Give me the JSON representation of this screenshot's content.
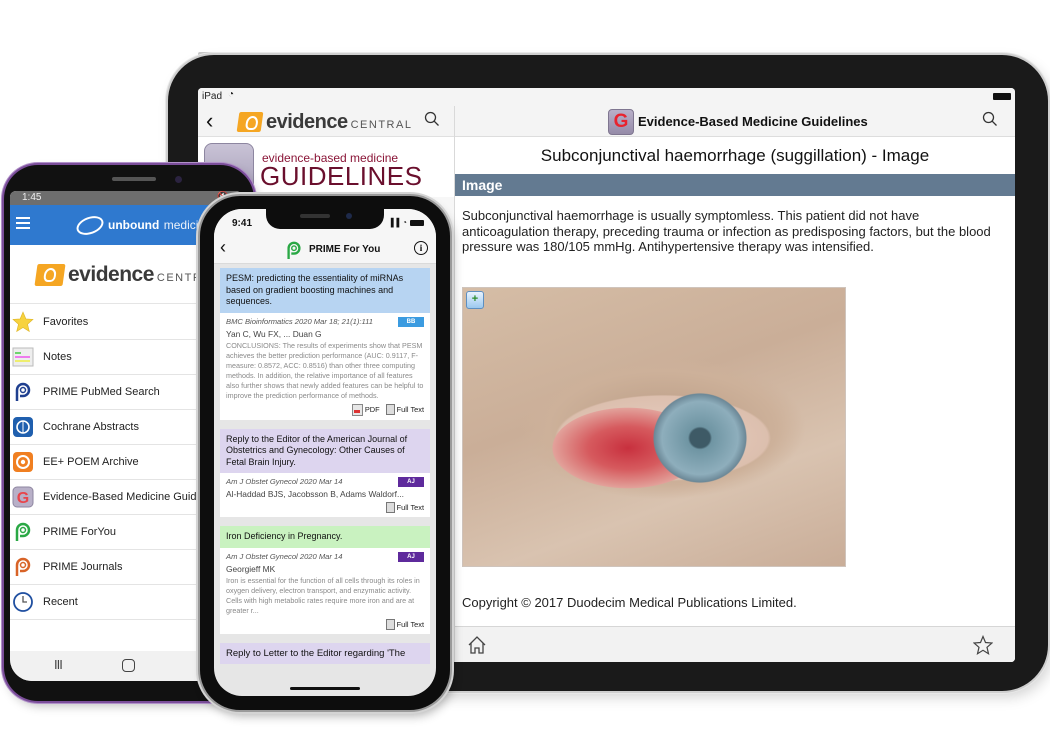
{
  "ipad": {
    "status": {
      "carrier": "iPad"
    },
    "left_pane": {
      "brand": {
        "word": "evidence",
        "suffix": "CENTRAL"
      },
      "banner": {
        "subtitle": "evidence-based medicine",
        "title": "GUIDELINES"
      }
    },
    "right_pane": {
      "app_icon_letter": "G",
      "nav_title": "Evidence-Based Medicine Guidelines",
      "doc_title": "Subconjunctival haemorrhage (suggillation) - Image",
      "section_header": "Image",
      "body": "Subconjunctival haemorrhage is usually symptomless. This patient did not have anticoagulation therapy, preceding trauma or infection as predisposing factors, but the blood pressure was 180/105 mmHg. Antihypertensive therapy was intensified.",
      "image_alt": "Photo of an eye with subconjunctival haemorrhage",
      "copyright": "Copyright © 2017 Duodecim Medical Publications Limited."
    },
    "colors": {
      "section_bar": "#637a91"
    }
  },
  "android": {
    "status": {
      "time": "1:45"
    },
    "header": {
      "brand_bold": "unbound",
      "brand_light": "medicine"
    },
    "logo": {
      "word": "evidence",
      "suffix": "CENTRAL"
    },
    "menu": [
      {
        "label": "Favorites",
        "icon": "star-icon"
      },
      {
        "label": "Notes",
        "icon": "notes-icon"
      },
      {
        "label": "PRIME PubMed Search",
        "icon": "prime-pubmed-icon"
      },
      {
        "label": "Cochrane Abstracts",
        "icon": "cochrane-icon"
      },
      {
        "label": "EE+ POEM Archive",
        "icon": "poem-archive-icon"
      },
      {
        "label": "Evidence-Based Medicine Guidelines",
        "icon": "guidelines-icon"
      },
      {
        "label": "PRIME ForYou",
        "icon": "prime-foryou-icon"
      },
      {
        "label": "PRIME Journals",
        "icon": "prime-journals-icon"
      },
      {
        "label": "Recent",
        "icon": "recent-clock-icon"
      }
    ],
    "navbar": {
      "recents": "III"
    },
    "colors": {
      "header": "#2f79cf"
    }
  },
  "iphone": {
    "status": {
      "time": "9:41"
    },
    "nav_title": "PRIME For You",
    "cards": [
      {
        "title": "PESM: predicting the essentiality of miRNAs based on gradient boosting machines and sequences.",
        "journal": "BMC Bioinformatics 2020 Mar 18; 21(1):111",
        "badge": "BB",
        "authors": "Yan C, Wu FX, ... Duan G",
        "abstract": "CONCLUSIONS: The results of experiments show that PESM achieves the better prediction performance (AUC: 0.9117, F-measure: 0.8572, ACC: 0.8516) than other three computing methods. In addition, the relative importance of all features also further shows that newly added features can be helpful to improve the prediction performance of methods.",
        "pdf_label": "PDF",
        "fulltext_label": "Full Text",
        "head_color": "#b7d4f2",
        "badge_color": "#3b9be0"
      },
      {
        "title": "Reply to the Editor of the American Journal of Obstetrics and Gynecology: Other Causes of Fetal Brain Injury.",
        "journal": "Am J Obstet Gynecol 2020 Mar 14",
        "badge": "AJ",
        "authors": "Al-Haddad BJS, Jacobsson B, Adams Waldorf...",
        "abstract": "",
        "fulltext_label": "Full Text",
        "head_color": "#ddd5ef",
        "badge_color": "#5e2a9c"
      },
      {
        "title": "Iron Deficiency in Pregnancy.",
        "journal": "Am J Obstet Gynecol 2020 Mar 14",
        "badge": "AJ",
        "authors": "Georgieff MK",
        "abstract": "Iron is essential for the function of all cells through its roles in oxygen delivery, electron transport, and enzymatic activity. Cells with high metabolic rates require more iron and are at greater r...",
        "fulltext_label": "Full Text",
        "head_color": "#c9f2c0",
        "badge_color": "#5e2a9c"
      },
      {
        "title": "Reply to Letter to the Editor regarding 'The",
        "head_color": "#ddd5ef"
      }
    ]
  }
}
